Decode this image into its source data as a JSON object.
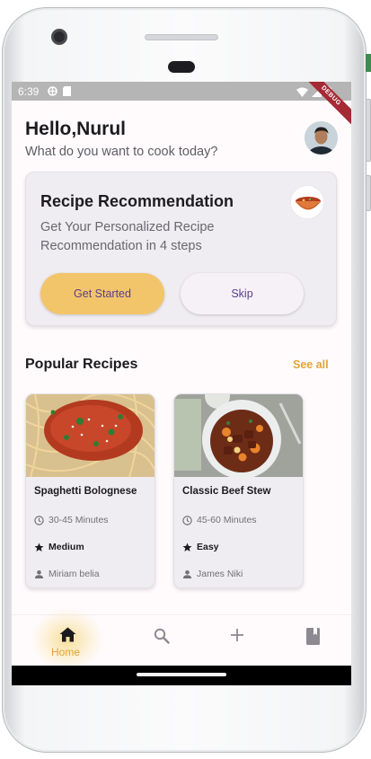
{
  "status_bar": {
    "time": "6:39",
    "debug_label": "DEBUG"
  },
  "header": {
    "greeting": "Hello,Nurul",
    "subtitle": "What do you want to cook today?"
  },
  "recommendation": {
    "title": "Recipe Recommendation",
    "description": "Get Your Personalized Recipe Recommendation in 4 steps",
    "start_label": "Get Started",
    "skip_label": "Skip"
  },
  "popular": {
    "title": "Popular Recipes",
    "see_all_label": "See all",
    "recipes": [
      {
        "name": "Spaghetti Bolognese",
        "time": "30-45 Minutes",
        "level": "Medium",
        "author": "Miriam belia"
      },
      {
        "name": "Classic Beef Stew",
        "time": "45-60 Minutes",
        "level": "Easy",
        "author": "James Niki"
      }
    ]
  },
  "bottom_nav": {
    "home_label": "Home",
    "items": [
      "home-icon",
      "search-icon",
      "add-icon",
      "book-icon"
    ]
  },
  "colors": {
    "accent": "#e0a53a",
    "primary_button": "#f3c56a",
    "button_text": "#5a3f8a",
    "card_bg": "#efedf1"
  }
}
